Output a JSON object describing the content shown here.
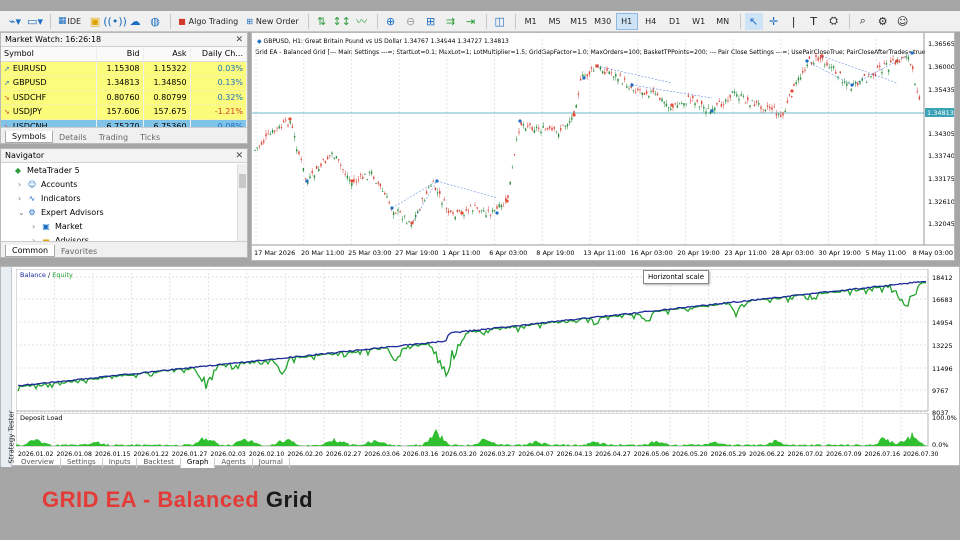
{
  "toolbar": {
    "ide": "IDE",
    "algo_trading": "Algo Trading",
    "new_order": "New Order",
    "timeframes": [
      "M1",
      "M5",
      "M15",
      "M30",
      "H1",
      "H4",
      "D1",
      "W1",
      "MN"
    ],
    "active_timeframe": "H1",
    "icons": [
      "chart-type-icon",
      "template-icon",
      "lock-icon",
      "signal-icon",
      "cloud-icon",
      "globe-icon",
      "algo-icon",
      "new-order-icon",
      "depth-icon",
      "trade-icon",
      "indicator-line-icon",
      "zoom-in-icon",
      "zoom-out-icon",
      "grid-icon",
      "scroll-icon",
      "autoscroll-icon",
      "screenshot-icon",
      "cursor-icon",
      "crosshair-icon",
      "vertical-line-icon",
      "text-tool-icon",
      "shapes-icon",
      "search-icon",
      "settings-icon",
      "user-icon"
    ]
  },
  "market_watch": {
    "title": "Market Watch: 16:26:18",
    "columns": [
      "Symbol",
      "Bid",
      "Ask",
      "Daily Ch..."
    ],
    "rows": [
      {
        "symbol": "EURUSD",
        "bid": "1.15308",
        "ask": "1.15322",
        "change": "0.03%",
        "dir": "up",
        "selected": false
      },
      {
        "symbol": "GBPUSD",
        "bid": "1.34813",
        "ask": "1.34850",
        "change": "0.13%",
        "dir": "up",
        "selected": false
      },
      {
        "symbol": "USDCHF",
        "bid": "0.80760",
        "ask": "0.80799",
        "change": "0.32%",
        "dir": "down",
        "selected": false
      },
      {
        "symbol": "USDJPY",
        "bid": "157.606",
        "ask": "157.675",
        "change": "-1.21%",
        "dir": "down",
        "selected": false
      },
      {
        "symbol": "USDCNH",
        "bid": "6.75270",
        "ask": "6.75360",
        "change": "0.08%",
        "dir": "down",
        "selected": true
      }
    ],
    "tabs": [
      "Symbols",
      "Details",
      "Trading",
      "Ticks"
    ],
    "active_tab": "Symbols"
  },
  "navigator": {
    "title": "Navigator",
    "items": [
      {
        "label": "MetaTrader 5",
        "level": 0,
        "icon": "metatrader-icon"
      },
      {
        "label": "Accounts",
        "level": 1,
        "icon": "accounts-icon"
      },
      {
        "label": "Indicators",
        "level": 1,
        "icon": "indicators-icon"
      },
      {
        "label": "Expert Advisors",
        "level": 1,
        "icon": "expert-advisors-icon"
      },
      {
        "label": "Market",
        "level": 2,
        "icon": "market-icon"
      },
      {
        "label": "Advisors",
        "level": 2,
        "icon": "folder-icon"
      }
    ],
    "tabs": [
      "Common",
      "Favorites"
    ],
    "active_tab": "Common"
  },
  "chart": {
    "header": "GBPUSD, H1:  Great Britain Pound vs US Dollar  1.34767 1.34944 1.34727 1.34813",
    "ea_line": "Grid EA - Balanced Grid [--- Main Settings ---=; StartLot=0.1; MaxLot=1; LotMultiplier=1.5; GridGapFactor=1.0; MaxOrders=100; BasketTPPoints=200; --- Pair Close Settings ---=; UsePairCloseTrue; PairCloseAfterTrades=true; Pair",
    "price_labels": [
      "1.36565",
      "1.36000",
      "1.35435",
      "1.34813",
      "1.34305",
      "1.33740",
      "1.33175",
      "1.32610",
      "1.32045"
    ],
    "current_price": "1.34813",
    "time_labels": [
      "17 Mar 2026",
      "20 Mar 11:00",
      "25 Mar 03:00",
      "27 Mar 19:00",
      "1 Apr 11:00",
      "6 Apr 03:00",
      "8 Apr 19:00",
      "13 Apr 11:00",
      "16 Apr 03:00",
      "20 Apr 19:00",
      "23 Apr 11:00",
      "28 Apr 03:00",
      "30 Apr 19:00",
      "5 May 11:00",
      "8 May 03:00"
    ]
  },
  "tester": {
    "side_label": "Strategy Tester",
    "balance_legend": {
      "balance": "Balance",
      "sep": " / ",
      "equity": "Equity"
    },
    "balance_axis": [
      "18412",
      "16683",
      "14954",
      "13225",
      "11496",
      "9767",
      "8037"
    ],
    "deposit_title": "Deposit Load",
    "deposit_axis": [
      "100.0%",
      "0.0%"
    ],
    "date_labels": [
      "2026.01.02",
      "2026.01.08",
      "2026.01.15",
      "2026.01.22",
      "2026.01.27",
      "2026.02.03",
      "2026.02.10",
      "2026.02.20",
      "2026.02.27",
      "2026.03.06",
      "2026.03.16",
      "2026.03.20",
      "2026.03.27",
      "2026.04.07",
      "2026.04.13",
      "2026.04.27",
      "2026.05.06",
      "2026.05.20",
      "2026.05.29",
      "2026.06.22",
      "2026.07.02",
      "2026.07.09",
      "2026.07.16",
      "2026.07.30"
    ],
    "tooltip": "Horizontal scale",
    "bottom_tabs": [
      "Overview",
      "Settings",
      "Inputs",
      "Backtest",
      "Graph",
      "Agents",
      "Journal"
    ],
    "colors": {
      "balance": "#1e2b99",
      "equity": "#1fa32a",
      "deposit": "#2fbf2f"
    }
  },
  "banner": {
    "part1": "GRID EA - Balanced",
    "part2": " Grid"
  }
}
